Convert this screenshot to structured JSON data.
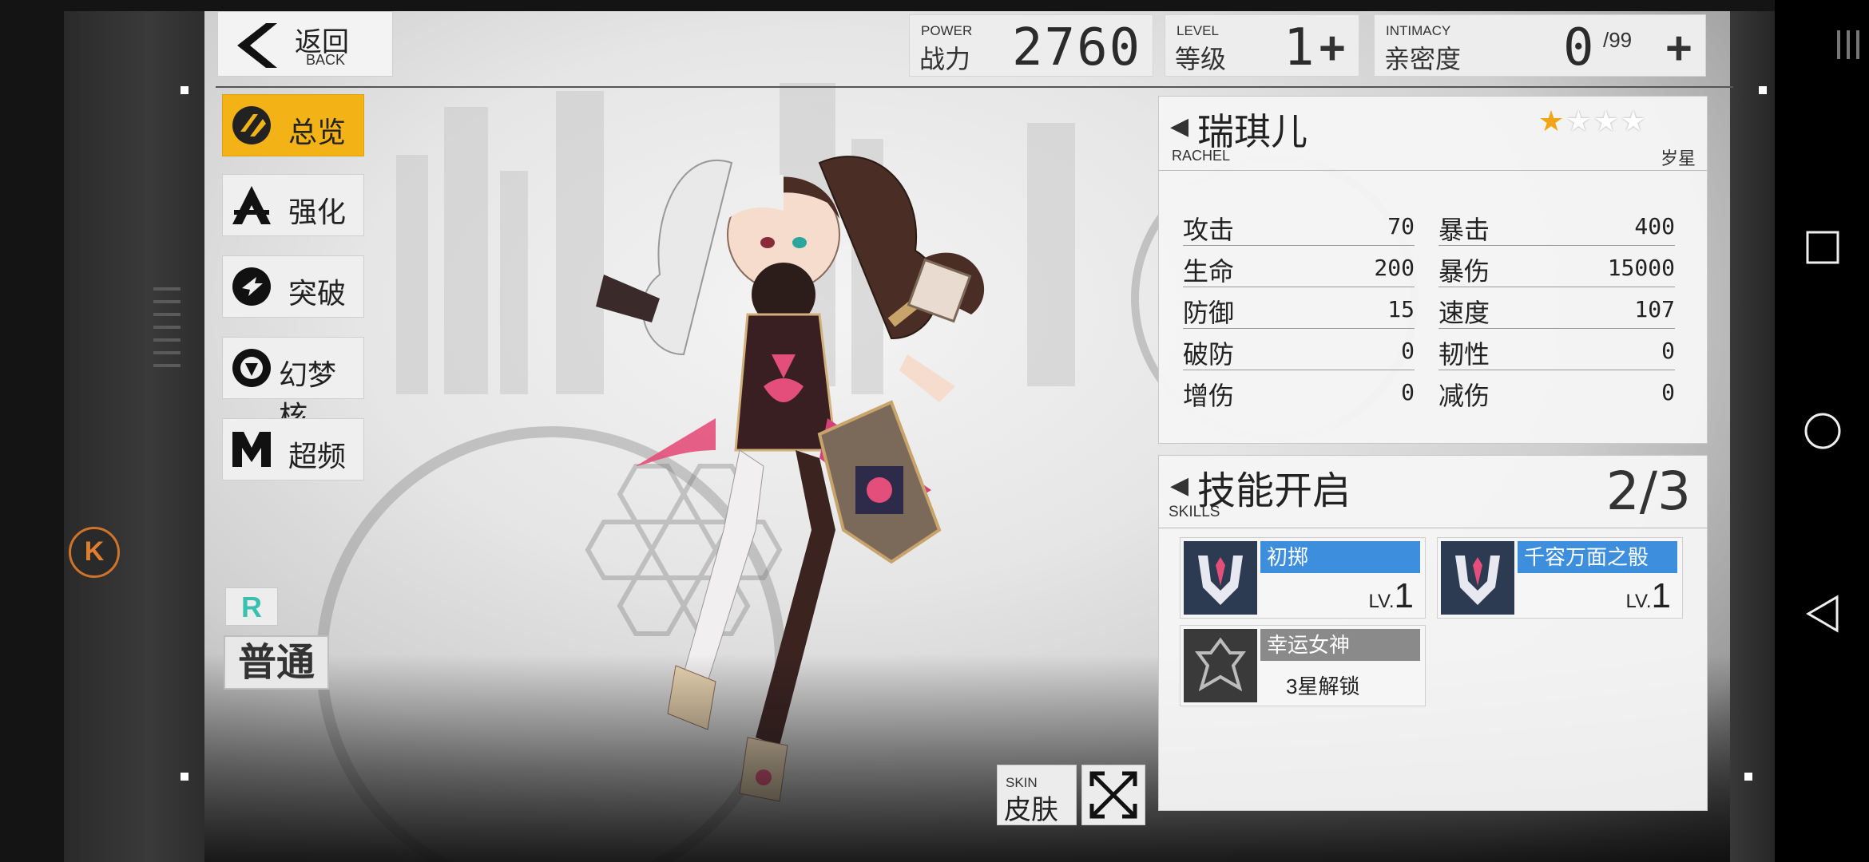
{
  "header": {
    "back": {
      "cn": "返回",
      "en": "BACK"
    },
    "power": {
      "en": "POWER",
      "cn": "战力",
      "value": "2760"
    },
    "level": {
      "en": "LEVEL",
      "cn": "等级",
      "value": "1",
      "plus": "+"
    },
    "intimacy": {
      "en": "INTIMACY",
      "cn": "亲密度",
      "value": "0",
      "max": "/99",
      "plus": "+"
    }
  },
  "nav": {
    "items": [
      {
        "label": "总览",
        "active": true
      },
      {
        "label": "强化"
      },
      {
        "label": "突破"
      },
      {
        "label": "幻梦核"
      },
      {
        "label": "超频"
      }
    ]
  },
  "rarity": {
    "badge": "R",
    "text": "普通"
  },
  "character": {
    "name": "瑞琪儿",
    "en_name": "RACHEL",
    "class": "岁星",
    "stars_on": 1,
    "stars_total": 4,
    "stats_left": [
      {
        "label": "攻击",
        "value": "70"
      },
      {
        "label": "生命",
        "value": "200"
      },
      {
        "label": "防御",
        "value": "15"
      },
      {
        "label": "破防",
        "value": "0"
      },
      {
        "label": "增伤",
        "value": "0"
      }
    ],
    "stats_right": [
      {
        "label": "暴击",
        "value": "400"
      },
      {
        "label": "暴伤",
        "value": "15000"
      },
      {
        "label": "速度",
        "value": "107"
      },
      {
        "label": "韧性",
        "value": "0"
      },
      {
        "label": "减伤",
        "value": "0"
      }
    ]
  },
  "skills": {
    "title": "技能开启",
    "en": "SKILLS",
    "count": "2/3",
    "items": [
      {
        "name": "初掷",
        "lv_prefix": "LV.",
        "lv": "1"
      },
      {
        "name": "千容万面之骰",
        "lv_prefix": "LV.",
        "lv": "1"
      },
      {
        "name": "幸运女神",
        "unlock": "3星解锁"
      }
    ]
  },
  "skin": {
    "en": "SKIN",
    "cn": "皮肤"
  },
  "colors": {
    "accent": "#f3b216",
    "skill_blue": "#3e8ede",
    "star": "#f1a415",
    "rarity_r": "#38c0b0"
  },
  "icons": [
    "back-arrow-icon",
    "overview-icon",
    "enhance-icon",
    "breakthrough-icon",
    "dream-core-icon",
    "overclock-icon",
    "expand-icon",
    "square-icon",
    "circle-icon",
    "triangle-back-icon"
  ]
}
